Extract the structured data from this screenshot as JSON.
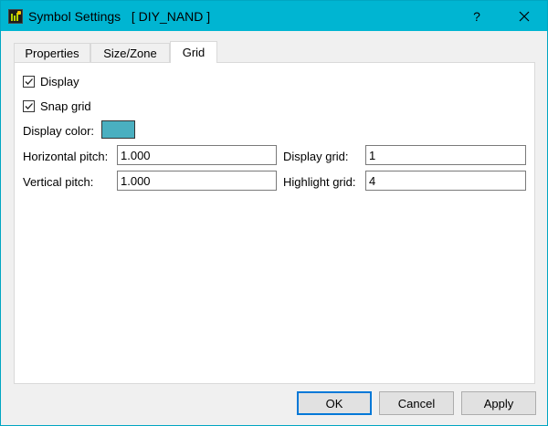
{
  "window": {
    "title": "Symbol Settings   [ DIY_NAND ]",
    "help_label": "?",
    "icon": "app-icon"
  },
  "tabs": [
    {
      "label": "Properties",
      "active": false
    },
    {
      "label": "Size/Zone",
      "active": false
    },
    {
      "label": "Grid",
      "active": true
    }
  ],
  "grid": {
    "display_label": "Display",
    "display_checked": true,
    "snap_label": "Snap grid",
    "snap_checked": true,
    "display_color_label": "Display color:",
    "display_color": "#4aafc0",
    "horizontal_pitch_label": "Horizontal pitch:",
    "horizontal_pitch": "1.000",
    "vertical_pitch_label": "Vertical pitch:",
    "vertical_pitch": "1.000",
    "display_grid_label": "Display grid:",
    "display_grid": "1",
    "highlight_grid_label": "Highlight grid:",
    "highlight_grid": "4"
  },
  "buttons": {
    "ok": "OK",
    "cancel": "Cancel",
    "apply": "Apply"
  },
  "colors": {
    "titlebar": "#00b5d2",
    "accent": "#0078d7"
  }
}
